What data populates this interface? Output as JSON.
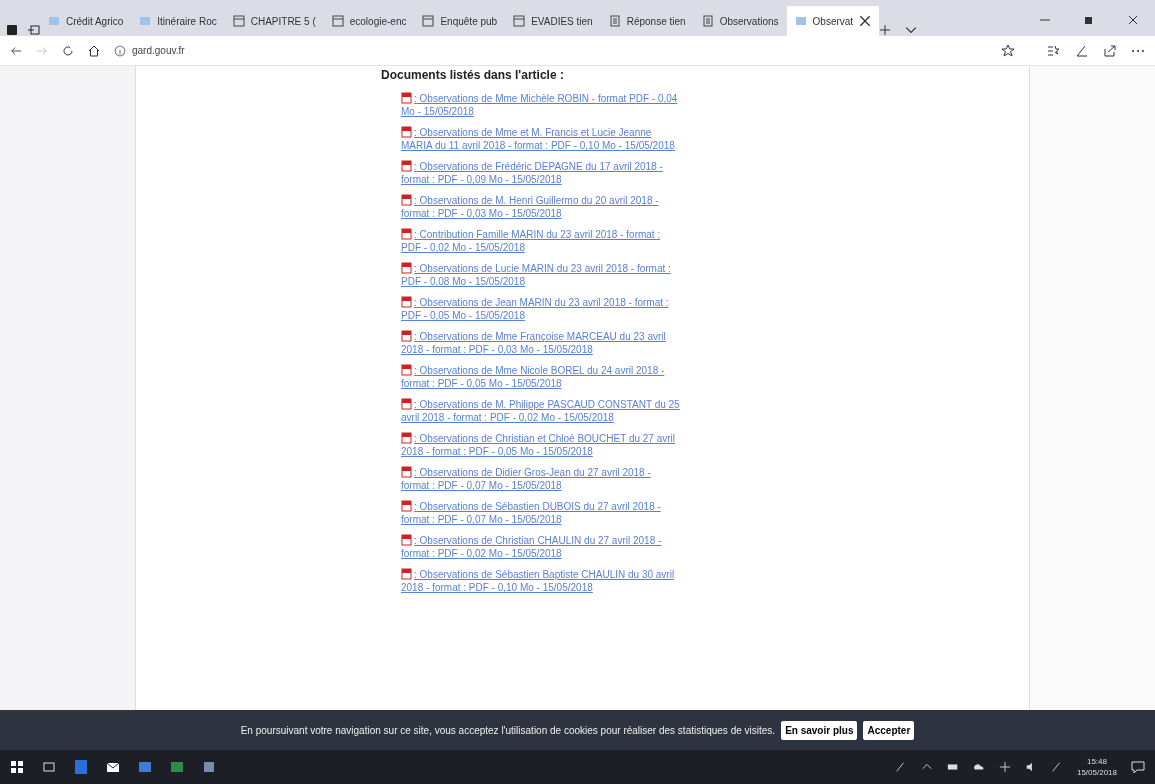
{
  "tabs": [
    {
      "label": "Crédit Agrico",
      "kind": "site",
      "selected": false
    },
    {
      "label": "Itinéraire Roc",
      "kind": "site",
      "selected": false
    },
    {
      "label": "CHAPITRE 5 (",
      "kind": "page",
      "selected": false
    },
    {
      "label": "ecologie-enc",
      "kind": "page",
      "selected": false
    },
    {
      "label": "Enquête pub",
      "kind": "page",
      "selected": false
    },
    {
      "label": "EVADIES tien",
      "kind": "page",
      "selected": false
    },
    {
      "label": "Réponse tien",
      "kind": "doc",
      "selected": false
    },
    {
      "label": "Observations",
      "kind": "doc",
      "selected": false
    },
    {
      "label": "Observat",
      "kind": "site",
      "selected": true
    }
  ],
  "address": "gard.gouv.fr",
  "heading": "Documents listés dans l'article :",
  "documents": [
    ":  Observations de Mme Michèle ROBIN - format PDF - 0,04 Mo - 15/05/2018",
    ":  Observations de Mme et M. Francis et Lucie Jeanne MARIA du 11 avril 2018 - format : PDF - 0,10 Mo - 15/05/2018",
    ":  Observations de Frédéric DEPAGNE du 17 avril 2018 - format : PDF - 0,09 Mo - 15/05/2018",
    ":  Observations de M. Henri Guillermo du 20 avril 2018 - format : PDF - 0,03 Mo - 15/05/2018",
    ":  Contribution Famille MARIN du 23 avril 2018 - format : PDF - 0,02 Mo - 15/05/2018",
    ":  Observations de Lucie MARIN du 23 avril 2018 - format : PDF - 0,08 Mo - 15/05/2018",
    ":  Observations de Jean MARIN du 23 avril 2018 - format : PDF - 0,05 Mo - 15/05/2018",
    ":  Observations de Mme Françoise MARCEAU du 23 avril 2018 - format : PDF - 0,03 Mo - 15/05/2018",
    ":  Observations de Mme Nicole BOREL du 24 avril 2018 - format : PDF - 0,05 Mo - 15/05/2018",
    ":  Observations de M. Philippe PASCAUD CONSTANT du 25 avril 2018 - format : PDF - 0,02 Mo - 15/05/2018",
    ":  Observations de Christian et Chloé BOUCHET du 27 avril 2018 - format : PDF - 0,05 Mo - 15/05/2018",
    ":  Observations de Didier Gros-Jean du 27 avril 2018 - format : PDF - 0,07 Mo - 15/05/2018",
    ":  Observations de Sébastien DUBOIS du 27 avril 2018 - format : PDF - 0,07 Mo - 15/05/2018",
    ":  Observations de Christian CHAULIN du 27 avril 2018 - format : PDF - 0,02 Mo - 15/05/2018",
    ":  Observations de Sébastien Baptiste CHAULIN du 30 avril 2018 - format : PDF - 0,10 Mo - 15/05/2018"
  ],
  "cookie_bar": {
    "text": "En poursuivant votre navigation sur ce site, vous acceptez l'utilisation de cookies pour réaliser des statistiques de visites.",
    "buttons": [
      "En savoir plus",
      "Accepter"
    ]
  },
  "taskbar": {
    "time": "15:48",
    "date": "15/05/2018"
  }
}
